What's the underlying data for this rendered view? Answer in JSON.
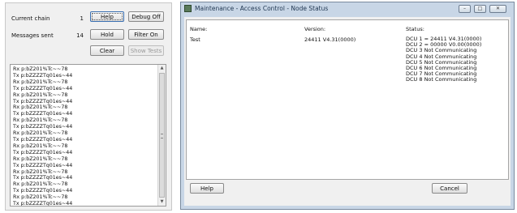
{
  "left_panel": {
    "current_chain_label": "Current chain",
    "current_chain_value": "1",
    "messages_sent_label": "Messages sent",
    "messages_sent_value": "14",
    "buttons": {
      "help": "Help",
      "debug_off": "Debug Off",
      "hold": "Hold",
      "filter_on": "Filter On",
      "clear": "Clear",
      "show_tests": "Show Tests"
    },
    "log_lines": [
      "Rx p:bZ201%Tc~~78",
      "Tx p:bZZZZTq01es~44",
      "Rx p:bZ201%Tc~~78",
      "Tx p:bZZZZTq01es~44",
      "Rx p:bZ201%Tc~~78",
      "Tx p:bZZZZTq01es~44",
      "Rx p:bZ201%Tc~~78",
      "Tx p:bZZZZTq01es~44",
      "Rx p:bZ201%Tc~~78",
      "Tx p:bZZZZTq01es~44",
      "Rx p:bZ201%Tc~~78",
      "Tx p:bZZZZTq01es~44",
      "Rx p:bZ201%Tc~~78",
      "Tx p:bZZZZTq01es~44",
      "Rx p:bZ201%Tc~~78",
      "Tx p:bZZZZTq01es~44",
      "Rx p:bZ201%Tc~~78",
      "Tx p:bZZZZTq01es~44",
      "Rx p:bZ201%Tc~~78",
      "Tx p:bZZZZTq01es~44",
      "Rx p:bZ201%Tc~~78",
      "Tx p:bZZZZTq01es~44"
    ]
  },
  "window": {
    "title": "Maintenance - Access Control - Node Status",
    "columns": {
      "name": "Name:",
      "version": "Version:",
      "status": "Status:"
    },
    "row": {
      "name": "Test",
      "version": "24411 V4.31(0000)",
      "status_lines": [
        "DCU 1 = 24411 V4.31(0000)",
        "DCU 2 = 00000 V0.00(0000)",
        "DCU 3 Not Communicating",
        "DCU 4 Not Communicating",
        "DCU 5 Not Communicating",
        "DCU 6 Not Communicating",
        "DCU 7 Not Communicating",
        "DCU 8 Not Communicating"
      ]
    },
    "help_button": "Help",
    "cancel_button": "Cancel",
    "minimize_glyph": "–",
    "maximize_glyph": "□",
    "close_glyph": "✕"
  }
}
